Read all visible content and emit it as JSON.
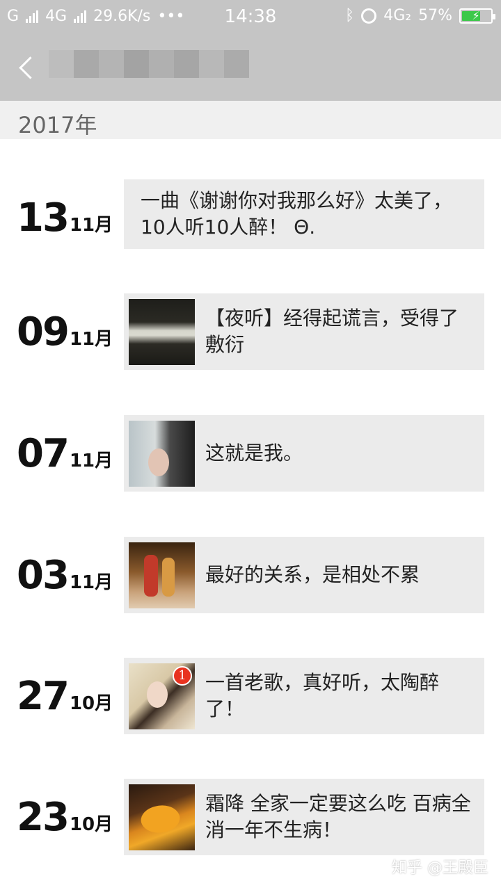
{
  "status_bar": {
    "carrier1": "G",
    "carrier2": "4G",
    "speed": "29.6K/s",
    "dots": "•••",
    "time": "14:38",
    "net": "4G₂",
    "battery": "57%"
  },
  "header": {
    "year": "2017年"
  },
  "entries": [
    {
      "day": "13",
      "month": "11月",
      "text": "一曲《谢谢你对我那么好》太美了，10人听10人醉！ Θ.",
      "thumb": null
    },
    {
      "day": "09",
      "month": "11月",
      "text": "【夜听】经得起谎言，受得了敷衍",
      "thumb": "dark-text-thumb"
    },
    {
      "day": "07",
      "month": "11月",
      "text": "这就是我。",
      "thumb": "woman-thumb"
    },
    {
      "day": "03",
      "month": "11月",
      "text": "最好的关系，是相处不累",
      "thumb": "kids-thumb"
    },
    {
      "day": "27",
      "month": "10月",
      "text": "一首老歌，真好听，太陶醉了！",
      "thumb": "painting-thumb",
      "badge": "1"
    },
    {
      "day": "23",
      "month": "10月",
      "text": "霜降 全家一定要这么吃 百病全消一年不生病！",
      "thumb": "leaf-thumb"
    }
  ],
  "watermark": "知乎 @王殿臣",
  "colors": {
    "topbar": "#c5c5c5",
    "card": "#ebebeb",
    "battery_fill": "#3cc84a",
    "badge": "#e8321f"
  }
}
